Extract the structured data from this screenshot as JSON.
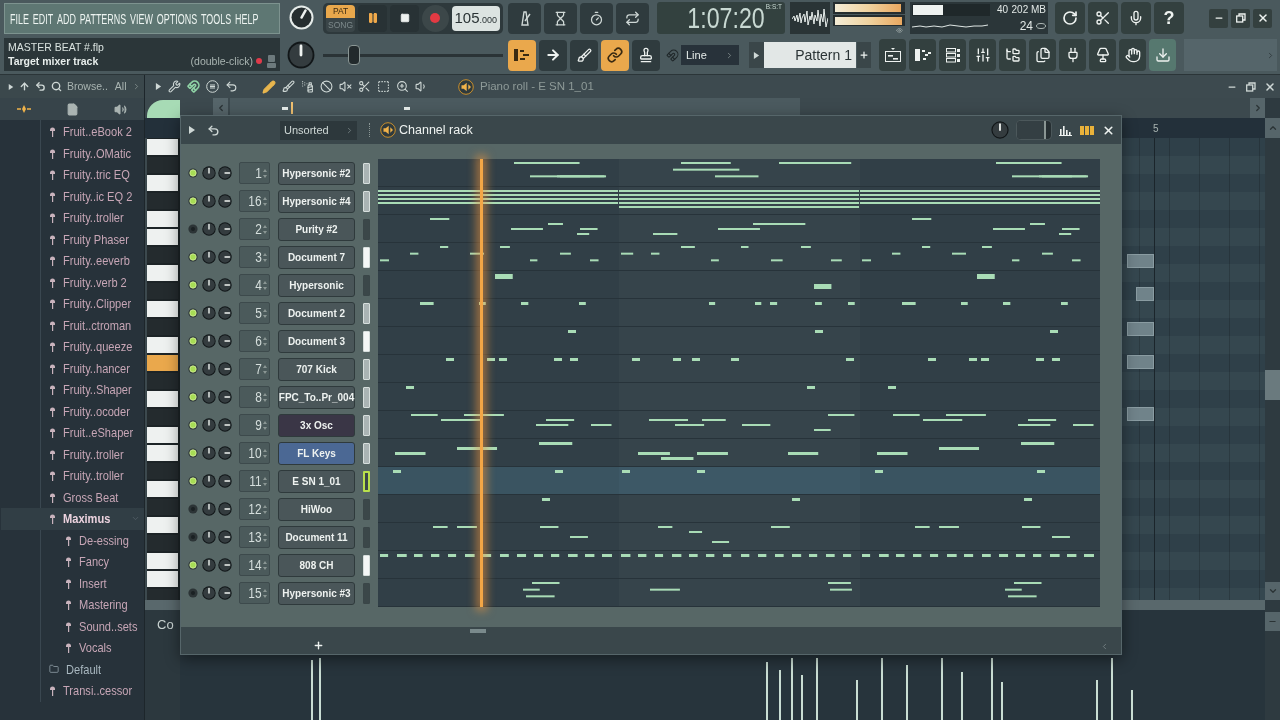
{
  "menu": [
    "FILE",
    "EDIT",
    "ADD",
    "PATTERNS",
    "VIEW",
    "OPTIONS",
    "TOOLS",
    "HELP"
  ],
  "project": {
    "filename": "MASTER BEAT #.flp",
    "hint_title": "Target mixer track",
    "hint_action": "(double-click)"
  },
  "transport": {
    "modes": [
      {
        "label": "PAT",
        "selected": true
      },
      {
        "label": "SONG",
        "selected": false
      }
    ],
    "playing": true,
    "tempo": "105",
    "tempo_fraction": ".000",
    "pitch": {
      "level": 0.15
    }
  },
  "time": {
    "value": "1:07:20",
    "format": "B:S:T"
  },
  "output_meters": [
    {
      "level": 0.97
    },
    {
      "level": 0.98
    }
  ],
  "cpu": {
    "level": 0.4,
    "reading": "40",
    "memory": "202 MB",
    "polyphony": "24"
  },
  "help": "?",
  "tools": [
    {
      "on": true
    },
    {
      "on": false
    },
    {
      "on": false
    },
    {
      "on": true
    },
    {
      "on": false
    }
  ],
  "snap": "Line",
  "pattern": "Pattern 1",
  "views": [
    {
      "on": false
    },
    {
      "on": false
    },
    {
      "on": false
    },
    {
      "on": false
    },
    {
      "on": false
    },
    {
      "on": false
    },
    {
      "on": false
    },
    {
      "on": false
    },
    {
      "on": false
    },
    {
      "on": true
    }
  ],
  "browser": {
    "label": "Browse..",
    "filter": "All",
    "items": [
      {
        "label": "Fruit..eBook 2",
        "kind": "plugin",
        "selected": false
      },
      {
        "label": "Fruity..OMatic",
        "kind": "plugin",
        "selected": false
      },
      {
        "label": "Fruity..tric EQ",
        "kind": "plugin",
        "selected": false
      },
      {
        "label": "Fruity..ic EQ 2",
        "kind": "plugin",
        "selected": false
      },
      {
        "label": "Fruity..troller",
        "kind": "plugin",
        "selected": false
      },
      {
        "label": "Fruity Phaser",
        "kind": "plugin",
        "selected": false
      },
      {
        "label": "Fruity..eeverb",
        "kind": "plugin",
        "selected": false
      },
      {
        "label": "Fruity..verb 2",
        "kind": "plugin",
        "selected": false
      },
      {
        "label": "Fruity..Clipper",
        "kind": "plugin",
        "selected": false
      },
      {
        "label": "Fruit..ctroman",
        "kind": "plugin",
        "selected": false
      },
      {
        "label": "Fruity..queeze",
        "kind": "plugin",
        "selected": false
      },
      {
        "label": "Fruity..hancer",
        "kind": "plugin",
        "selected": false
      },
      {
        "label": "Fruity..Shaper",
        "kind": "plugin",
        "selected": false
      },
      {
        "label": "Fruity..ocoder",
        "kind": "plugin",
        "selected": false
      },
      {
        "label": "Fruit..eShaper",
        "kind": "plugin",
        "selected": false
      },
      {
        "label": "Fruity..troller",
        "kind": "plugin",
        "selected": false
      },
      {
        "label": "Fruity..troller",
        "kind": "plugin",
        "selected": false
      },
      {
        "label": "Gross Beat",
        "kind": "plugin",
        "selected": false
      },
      {
        "label": "Maximus",
        "kind": "plugin",
        "selected": true,
        "expanded": true,
        "children": [
          {
            "label": "De-essing",
            "kind": "plugin",
            "selected": false
          },
          {
            "label": "Fancy",
            "kind": "plugin",
            "selected": false
          },
          {
            "label": "Insert",
            "kind": "plugin",
            "selected": false
          },
          {
            "label": "Mastering",
            "kind": "plugin",
            "selected": false
          },
          {
            "label": "Sound..sets",
            "kind": "plugin",
            "selected": false
          },
          {
            "label": "Vocals",
            "kind": "plugin",
            "selected": false
          }
        ]
      },
      {
        "label": "Default",
        "kind": "folder",
        "selected": false
      },
      {
        "label": "Transi..cessor",
        "kind": "plugin",
        "selected": false
      }
    ]
  },
  "piano_roll": {
    "title": "Piano roll - E SN 1_01",
    "bar": "5",
    "event_label": "Co"
  },
  "channel_rack": {
    "filter": "Unsorted",
    "title": "Channel rack",
    "swing": {
      "level": 0.85
    },
    "channels": [
      {
        "number": "1",
        "name": "Hypersonic #2",
        "enabled": true,
        "color": "#4a5659",
        "selected": true,
        "playing": false,
        "focused": false
      },
      {
        "number": "16",
        "name": "Hypersonic #4",
        "enabled": true,
        "color": "#4a5659",
        "selected": true,
        "playing": false,
        "focused": false
      },
      {
        "number": "2",
        "name": "Purity #2",
        "enabled": false,
        "color": "#4a5659",
        "selected": false,
        "playing": false,
        "focused": false
      },
      {
        "number": "3",
        "name": "Document 7",
        "enabled": true,
        "color": "#4a5659",
        "selected": true,
        "playing": true,
        "focused": false
      },
      {
        "number": "4",
        "name": "Hypersonic",
        "enabled": true,
        "color": "#4a5659",
        "selected": false,
        "playing": false,
        "focused": false
      },
      {
        "number": "5",
        "name": "Document 2",
        "enabled": true,
        "color": "#4a5659",
        "selected": true,
        "playing": false,
        "focused": false
      },
      {
        "number": "6",
        "name": "Document 3",
        "enabled": true,
        "color": "#4a5659",
        "selected": true,
        "playing": true,
        "focused": false
      },
      {
        "number": "7",
        "name": "707 Kick",
        "enabled": true,
        "color": "#4a5659",
        "selected": true,
        "playing": false,
        "focused": false
      },
      {
        "number": "8",
        "name": "FPC_To..Pr_004",
        "enabled": true,
        "color": "#4a5659",
        "selected": true,
        "playing": false,
        "focused": false
      },
      {
        "number": "9",
        "name": "3x Osc",
        "enabled": true,
        "color": "#3a3646",
        "selected": true,
        "playing": false,
        "focused": false
      },
      {
        "number": "10",
        "name": "FL Keys",
        "enabled": true,
        "color": "#4b6894",
        "selected": true,
        "playing": false,
        "focused": false
      },
      {
        "number": "11",
        "name": "E SN 1_01",
        "enabled": true,
        "color": "#4a5659",
        "selected": false,
        "playing": false,
        "focused": true
      },
      {
        "number": "12",
        "name": "HiWoo",
        "enabled": false,
        "color": "#4a5659",
        "selected": false,
        "playing": false,
        "focused": false
      },
      {
        "number": "13",
        "name": "Document 11",
        "enabled": false,
        "color": "#4a5659",
        "selected": false,
        "playing": false,
        "focused": false
      },
      {
        "number": "14",
        "name": "808 CH",
        "enabled": true,
        "color": "#4a5659",
        "selected": true,
        "playing": true,
        "focused": false
      },
      {
        "number": "15",
        "name": "Hypersonic #3",
        "enabled": false,
        "color": "#4a5659",
        "selected": false,
        "playing": false,
        "focused": false
      }
    ]
  }
}
